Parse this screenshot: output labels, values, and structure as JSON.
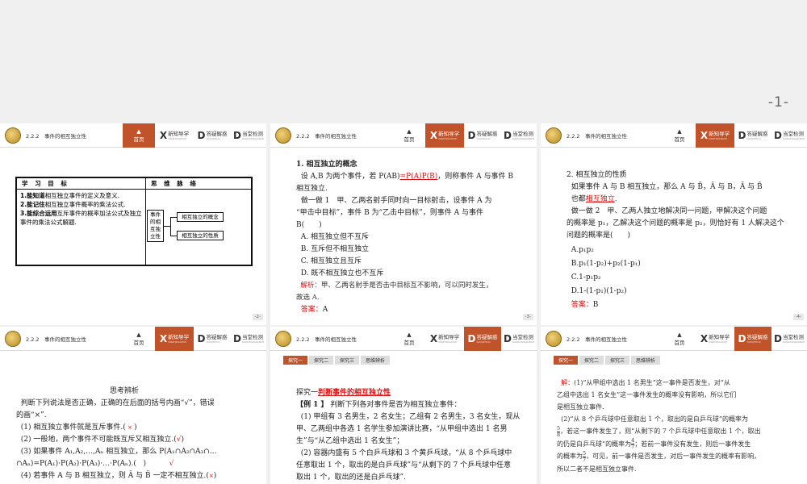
{
  "top": {
    "page_number": "-1-"
  },
  "header": {
    "section": "2.2.2　事件的相互独立性",
    "home_label": "首页",
    "nav_x_big": "X",
    "nav_x_label": "新知导学",
    "nav_x_en": "XINZHIDAOXUE",
    "nav_d1_big": "D",
    "nav_d1_label": "答疑解惑",
    "nav_d1_en": "DAYIJIEHUO",
    "nav_d2_big": "D",
    "nav_d2_label": "当堂检测",
    "nav_d2_en": "DANGTANGJIANCE"
  },
  "slide1": {
    "col1_header": "学 习 目 标",
    "col2_header": "思 维 脉 络",
    "goal1_bold": "1.能知道",
    "goal1_rest": "相互独立事件的定义及意义.",
    "goal2_bold": "2.能记住",
    "goal2_rest": "相互独立事件概率的乘法公式.",
    "goal3_bold": "3.能综合运用",
    "goal3_rest": "互斥事件的概率加法公式及独立事件的乘法公式解题.",
    "mm_root": "事件的相互独立性",
    "mm_branch1": "相互独立的概念",
    "mm_branch2": "相互独立的性质",
    "page": "-2-"
  },
  "slide2": {
    "heading": "1. 相互独立的概念",
    "l1a": "设 A,B 为两个事件，若 P(AB)",
    "l1b": "=P(A)P(B)",
    "l1c": "，则称事件 A 与事件 B",
    "l2": "相互独立.",
    "l3": "做一做 1　甲、乙两名射手同时向一目标射击，设事件 A 为",
    "l4": "“甲击中目标”，事件 B 为“乙击中目标”，则事件 A 与事件",
    "l5": "B(　　)",
    "optA": "A. 相互独立但不互斥",
    "optB": "B. 互斥但不相互独立",
    "optC": "C. 相互独立且互斥",
    "optD": "D. 既不相互独立也不互斥",
    "analysis_label": "解析：",
    "analysis": "甲、乙两名射手是否击中目标互不影响，可以同时发生，",
    "analysis2": "故选 A.",
    "answer_label": "答案：",
    "answer": "A",
    "page": "-3-"
  },
  "slide3": {
    "heading": "2. 相互独立的性质",
    "l1a": "如果事件 A 与 B 相互独立，那么 A 与 B̄，Ā 与 B，Ā 与 B̄",
    "l2a": "也都",
    "l2b": "相互独立",
    "l2c": ".",
    "l3": "做一做 2　甲、乙两人独立地解决同一问题，甲解决这个问题",
    "l4": "的概率是 p₁，乙解决这个问题的概率是 p₂，则恰好有 1 人解决这个",
    "l5": "问题的概率是(　　)",
    "optA": "A.p₁p₂",
    "optB": "B.p₁(1-p₂)+p₂(1-p₁)",
    "optC": "C.1-p₁p₂",
    "optD": "D.1-(1-p₁)(1-p₂)",
    "answer_label": "答案：",
    "answer": "B",
    "page": "-4-"
  },
  "slide4": {
    "heading": "思考辨析",
    "intro1": "判断下列说法是否正确，正确的在后面的括号内画“√”，错误",
    "intro2": "的画“×”.",
    "q1": "(1) 相互独立事件就是互斥事件.(",
    "q1m": "×",
    "q1e": ")",
    "q2": "(2) 一般地，两个事件不可能既互斥又相互独立.(",
    "q2m": "√",
    "q2e": ")",
    "q3": "(3) 如果事件 A₁,A₂,…,Aₙ 相互独立，那么 P(A₁∩A₂∩A₃∩…",
    "q3b": "∩Aₙ)=P(A₁)·P(A₂)·P(A₃)·…·P(Aₙ).(",
    "q3m": "√",
    "q3e": ")",
    "q4": "(4) 若事件 A 与 B 相互独立，则 Ā 与 B̄ 一定不相互独立.(",
    "q4m": "×",
    "q4e": ")"
  },
  "slide5": {
    "tabs": [
      "探究一",
      "探究二",
      "探究三",
      "思维辨析"
    ],
    "title_a": "探究一",
    "title_b": "判断事件的相互独立性",
    "ex_label": "【例 1 】",
    "ex": "判断下列各对事件是否为相互独立事件：",
    "p1": "(1) 甲组有 3 名男生，2 名女生；乙组有 2 名男生，3 名女生，现从",
    "p1b": "甲、乙两组中各选 1 名学生参加演讲比赛，“从甲组中选出 1 名男",
    "p1c": "生”与“从乙组中选出 1 名女生”；",
    "p2": "(2) 容器内盛有 5 个白乒乓球和 3 个黄乒乓球，“从 8 个乒乓球中",
    "p2b": "任意取出 1 个，取出的是白乒乓球”与“从剩下的 7 个乒乓球中任意",
    "p2c": "取出 1 个，取出的还是白乒乓球”."
  },
  "slide6": {
    "tabs": [
      "探究一",
      "探究二",
      "探究三",
      "思维辨析"
    ],
    "sol_label": "解：",
    "s1": "(1)“从甲组中选出 1 名男生”这一事件是否发生，对“从",
    "s1b": "乙组中选出 1 名女生”这一事件发生的概率没有影响，所以它们",
    "s1c": "是相互独立事件.",
    "s2": "(2)“从 8 个乒乓球中任意取出 1 个，取出的是白乒乓球”的概率为",
    "f1n": "5",
    "f1d": "8",
    "s2b": "，若这一事件发生了，则“从剩下的 7 个乒乓球中任意取出 1 个，取出",
    "s2c": "的仍是白乒乓球”的概率为",
    "f2n": "4",
    "f2d": "7",
    "s2d": "；若前一事件没有发生，则后一事件发生",
    "s2e": "的概率为",
    "f3n": "5",
    "f3d": "7",
    "s2f": "，可见，前一事件是否发生，对后一事件发生的概率有影响，",
    "s2g": "所以二者不是相互独立事件."
  }
}
